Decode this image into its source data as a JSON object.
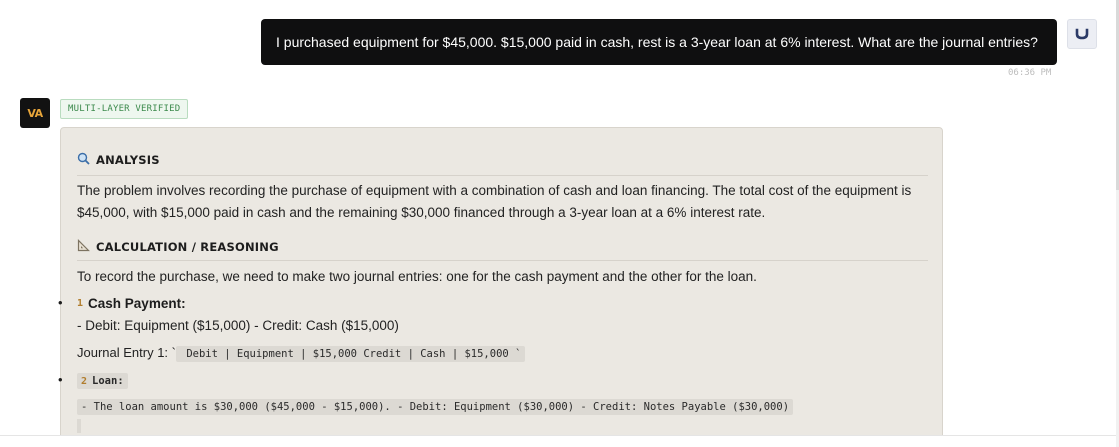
{
  "user_message": {
    "text": "I purchased equipment for $45,000. $15,000 paid in cash, rest is a 3-year loan at 6% interest. What are the journal entries?",
    "avatar_icon": "user-icon",
    "timestamp": "06:36 PM"
  },
  "assistant": {
    "avatar_label": "VA",
    "badge": "MULTI-LAYER VERIFIED",
    "analysis": {
      "icon": "magnifier-icon",
      "heading": "ANALYSIS",
      "text": "The problem involves recording the purchase of equipment with a combination of cash and loan financing. The total cost of the equipment is $45,000, with $15,000 paid in cash and the remaining $30,000 financed through a 3-year loan at a 6% interest rate."
    },
    "calculation": {
      "icon": "triangle-ruler-icon",
      "heading": "CALCULATION / REASONING",
      "intro": "To record the purchase, we need to make two journal entries: one for the cash payment and the other for the loan.",
      "items": [
        {
          "num": "1",
          "title": "Cash Payment:",
          "detail": "- Debit: Equipment ($15,000) - Credit: Cash ($15,000)",
          "journal_label": "Journal Entry 1: `",
          "journal_code": " Debit | Equipment | $15,000 Credit | Cash | $15,000 `"
        },
        {
          "num": "2",
          "title": "Loan:",
          "detail": "- The loan amount is $30,000 ($45,000 - $15,000). - Debit: Equipment ($30,000) - Credit: Notes Payable ($30,000)"
        }
      ]
    }
  },
  "colors": {
    "user_bubble": "#0f0f10",
    "card_bg": "#ebe8e2",
    "badge_green": "#3c8a4c",
    "accent_orange": "#e7a53a"
  }
}
